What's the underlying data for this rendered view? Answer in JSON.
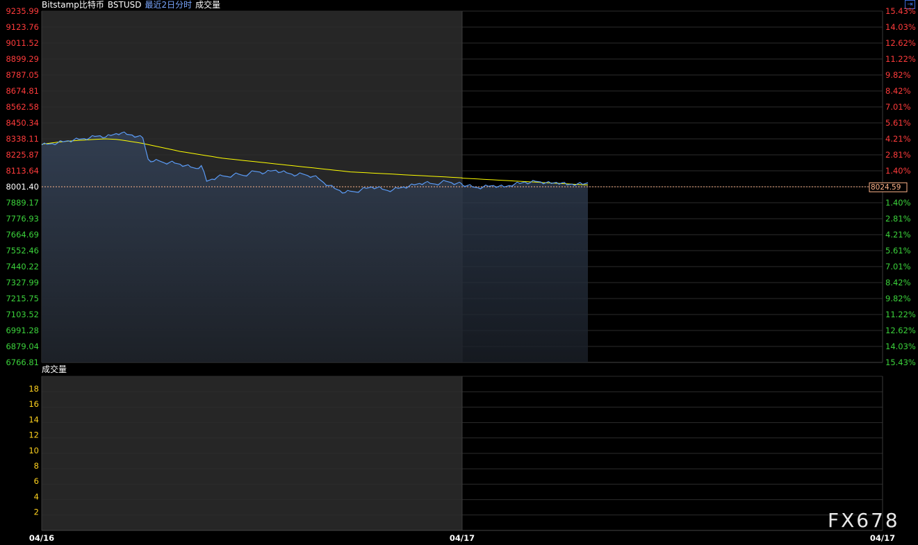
{
  "header": {
    "exchange": "Bitstamp比特币",
    "symbol": "BSTUSD",
    "period": "最近2日分时",
    "indicator": "成交量"
  },
  "volume_panel": {
    "title": "成交量"
  },
  "corner_button": {
    "icon": "exit-icon",
    "glyph": "⇥"
  },
  "watermark": "FX678",
  "colors": {
    "up": "#ff3b3b",
    "down": "#3bd23b",
    "price_line": "#5b9bf5",
    "avg_line": "#ffff00",
    "grid": "#2c2c2c",
    "ref_line": "#ffb38a",
    "volume_axis": "#ffd21e",
    "current_label": "#ffb38a"
  },
  "current_price_label": "8024.59",
  "price_axis": {
    "labels": [
      "9235.99",
      "9123.76",
      "9011.52",
      "8899.29",
      "8787.05",
      "8674.81",
      "8562.58",
      "8450.34",
      "8338.11",
      "8225.87",
      "8113.64",
      "8001.40",
      "7889.17",
      "7776.93",
      "7664.69",
      "7552.46",
      "7440.22",
      "7327.99",
      "7215.75",
      "7103.52",
      "6991.28",
      "6879.04",
      "6766.81"
    ]
  },
  "percent_axis": {
    "labels": [
      "15.43%",
      "14.03%",
      "12.62%",
      "11.22%",
      "9.82%",
      "8.42%",
      "7.01%",
      "5.61%",
      "4.21%",
      "2.81%",
      "1.40%",
      "",
      "1.40%",
      "2.81%",
      "4.21%",
      "5.61%",
      "7.01%",
      "8.42%",
      "9.82%",
      "11.22%",
      "12.62%",
      "14.03%",
      "15.43%"
    ]
  },
  "volume_axis": {
    "labels": [
      "18",
      "16",
      "14",
      "12",
      "10",
      "8",
      "6",
      "4",
      "2"
    ]
  },
  "x_axis": {
    "labels": [
      "04/16",
      "04/17",
      "04/17"
    ]
  },
  "chart_data": {
    "type": "line",
    "ylim": [
      6766.81,
      9235.99
    ],
    "reference_price": 8001.4,
    "last_price": 8024.59,
    "x_label_days": [
      "04/16",
      "04/17"
    ],
    "series": [
      {
        "name": "",
        "values": [
          8295,
          8300,
          8305,
          8310,
          8318,
          8325,
          8330,
          8335,
          8340,
          8345,
          8355,
          8360,
          8350,
          8362,
          8375,
          8380,
          8370,
          8365,
          8355,
          8345,
          8195,
          8180,
          8185,
          8170,
          8172,
          8168,
          8160,
          8150,
          8140,
          8130,
          8150,
          8040,
          8055,
          8070,
          8078,
          8072,
          8085,
          8090,
          8080,
          8095,
          8110,
          8105,
          8100,
          8112,
          8118,
          8105,
          8100,
          8090,
          8085,
          8092,
          8080,
          8075,
          8060,
          8030,
          8010,
          7990,
          7975,
          7960,
          7970,
          7965,
          7980,
          7990,
          8000,
          7995,
          7985,
          7975,
          7980,
          7990,
          8000,
          8005,
          8015,
          8025,
          8030,
          8025,
          8020,
          8030,
          8040,
          8030,
          8025,
          8020,
          8015,
          8010,
          8000,
          7995,
          8000,
          8005,
          8010,
          8005,
          8000,
          8010,
          8020,
          8025,
          8035,
          8030,
          8040,
          8035,
          8030,
          8025,
          8032,
          8028,
          8015,
          8020,
          8022,
          8018,
          8030
        ]
      },
      {
        "name": "",
        "values": [
          8300,
          8305,
          8310,
          8315,
          8318,
          8322,
          8325,
          8328,
          8330,
          8332,
          8334,
          8336,
          8338,
          8336,
          8334,
          8330,
          8324,
          8318,
          8312,
          8306,
          8298,
          8290,
          8282,
          8274,
          8266,
          8258,
          8250,
          8244,
          8238,
          8232,
          8226,
          8220,
          8214,
          8208,
          8202,
          8198,
          8194,
          8190,
          8186,
          8182,
          8178,
          8174,
          8170,
          8166,
          8162,
          8158,
          8154,
          8150,
          8146,
          8142,
          8138,
          8134,
          8130,
          8126,
          8122,
          8118,
          8114,
          8110,
          8106,
          8104,
          8102,
          8100,
          8098,
          8096,
          8094,
          8092,
          8090,
          8088,
          8086,
          8084,
          8082,
          8080,
          8078,
          8076,
          8074,
          8072,
          8070,
          8068,
          8066,
          8064,
          8062,
          8060,
          8058,
          8056,
          8054,
          8052,
          8050,
          8048,
          8046,
          8044,
          8042,
          8040,
          8038,
          8036,
          8034,
          8032,
          8030,
          8028,
          8026,
          8024,
          8022,
          8020,
          8018,
          8016,
          8014
        ]
      }
    ],
    "volume": []
  }
}
